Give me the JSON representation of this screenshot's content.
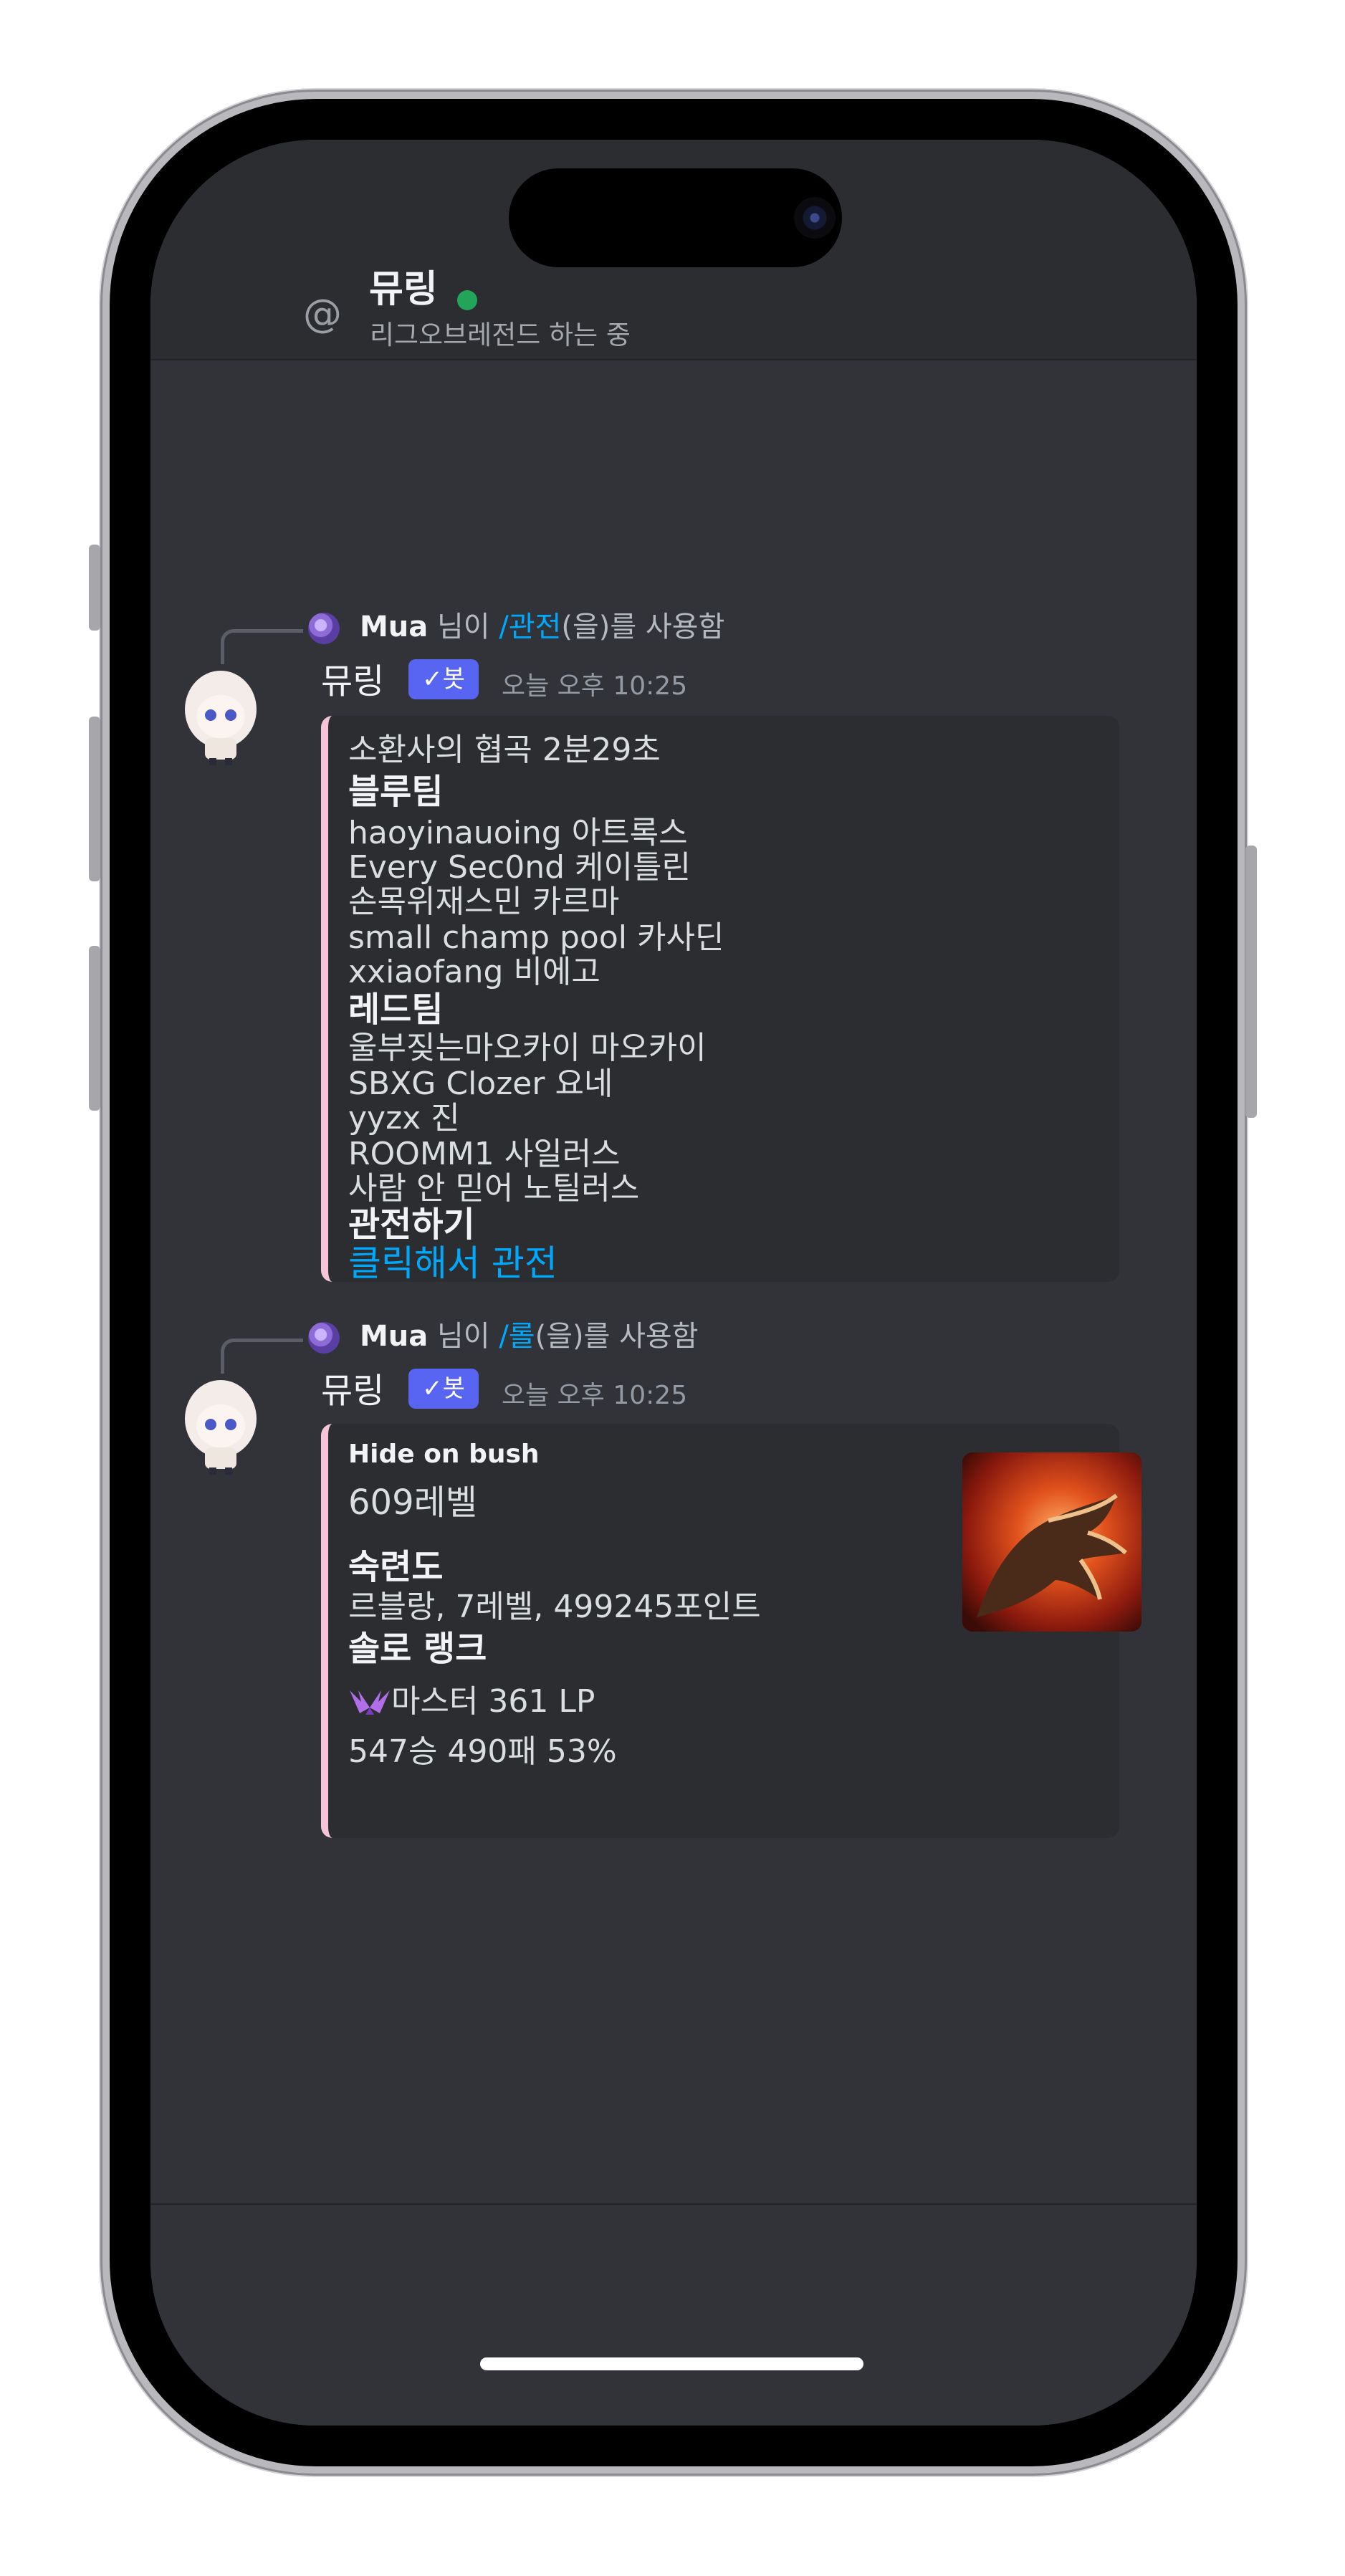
{
  "header": {
    "name": "뮤링",
    "status": "리그오브레전드 하는 중"
  },
  "messages": [
    {
      "reply": {
        "user": "Mua",
        "prefix": " 님이 ",
        "command": "/관전",
        "suffix": "(을)를 사용함"
      },
      "author": "뮤링",
      "bot_tag": "✓봇",
      "time": "오늘 오후 10:25",
      "embed": {
        "lines": [
          "소환사의 협곡  2분29초",
          "블루팀",
          "haoyinauoing 아트록스",
          "Every Sec0nd 케이틀린",
          "손목위재스민 카르마",
          "small champ pool 카사딘",
          "xxiaofang 비에고",
          "레드팀",
          "울부짖는마오카이 마오카이",
          "SBXG Clozer 요네",
          "yyzx 진",
          "ROOMM1 사일러스",
          "사람 안 믿어 노틸러스",
          "관전하기",
          "클릭해서 관전"
        ]
      }
    },
    {
      "reply": {
        "user": "Mua",
        "prefix": " 님이 ",
        "command": "/롤",
        "suffix": "(을)를 사용함"
      },
      "author": "뮤링",
      "bot_tag": "✓봇",
      "time": "오늘 오후 10:25",
      "embed": {
        "author": "Hide on bush",
        "lines": [
          "609레벨",
          "숙련도",
          "르블랑, 7레벨, 499245포인트",
          "솔로 랭크",
          "마스터 361 LP",
          "547승 490패 53%"
        ]
      }
    }
  ],
  "colors": {
    "background": "#313338",
    "header": "#2b2d31",
    "embed_border": "#f6c4d7",
    "link": "#00a8fc",
    "bot_tag": "#5865f2",
    "online": "#23a559"
  }
}
